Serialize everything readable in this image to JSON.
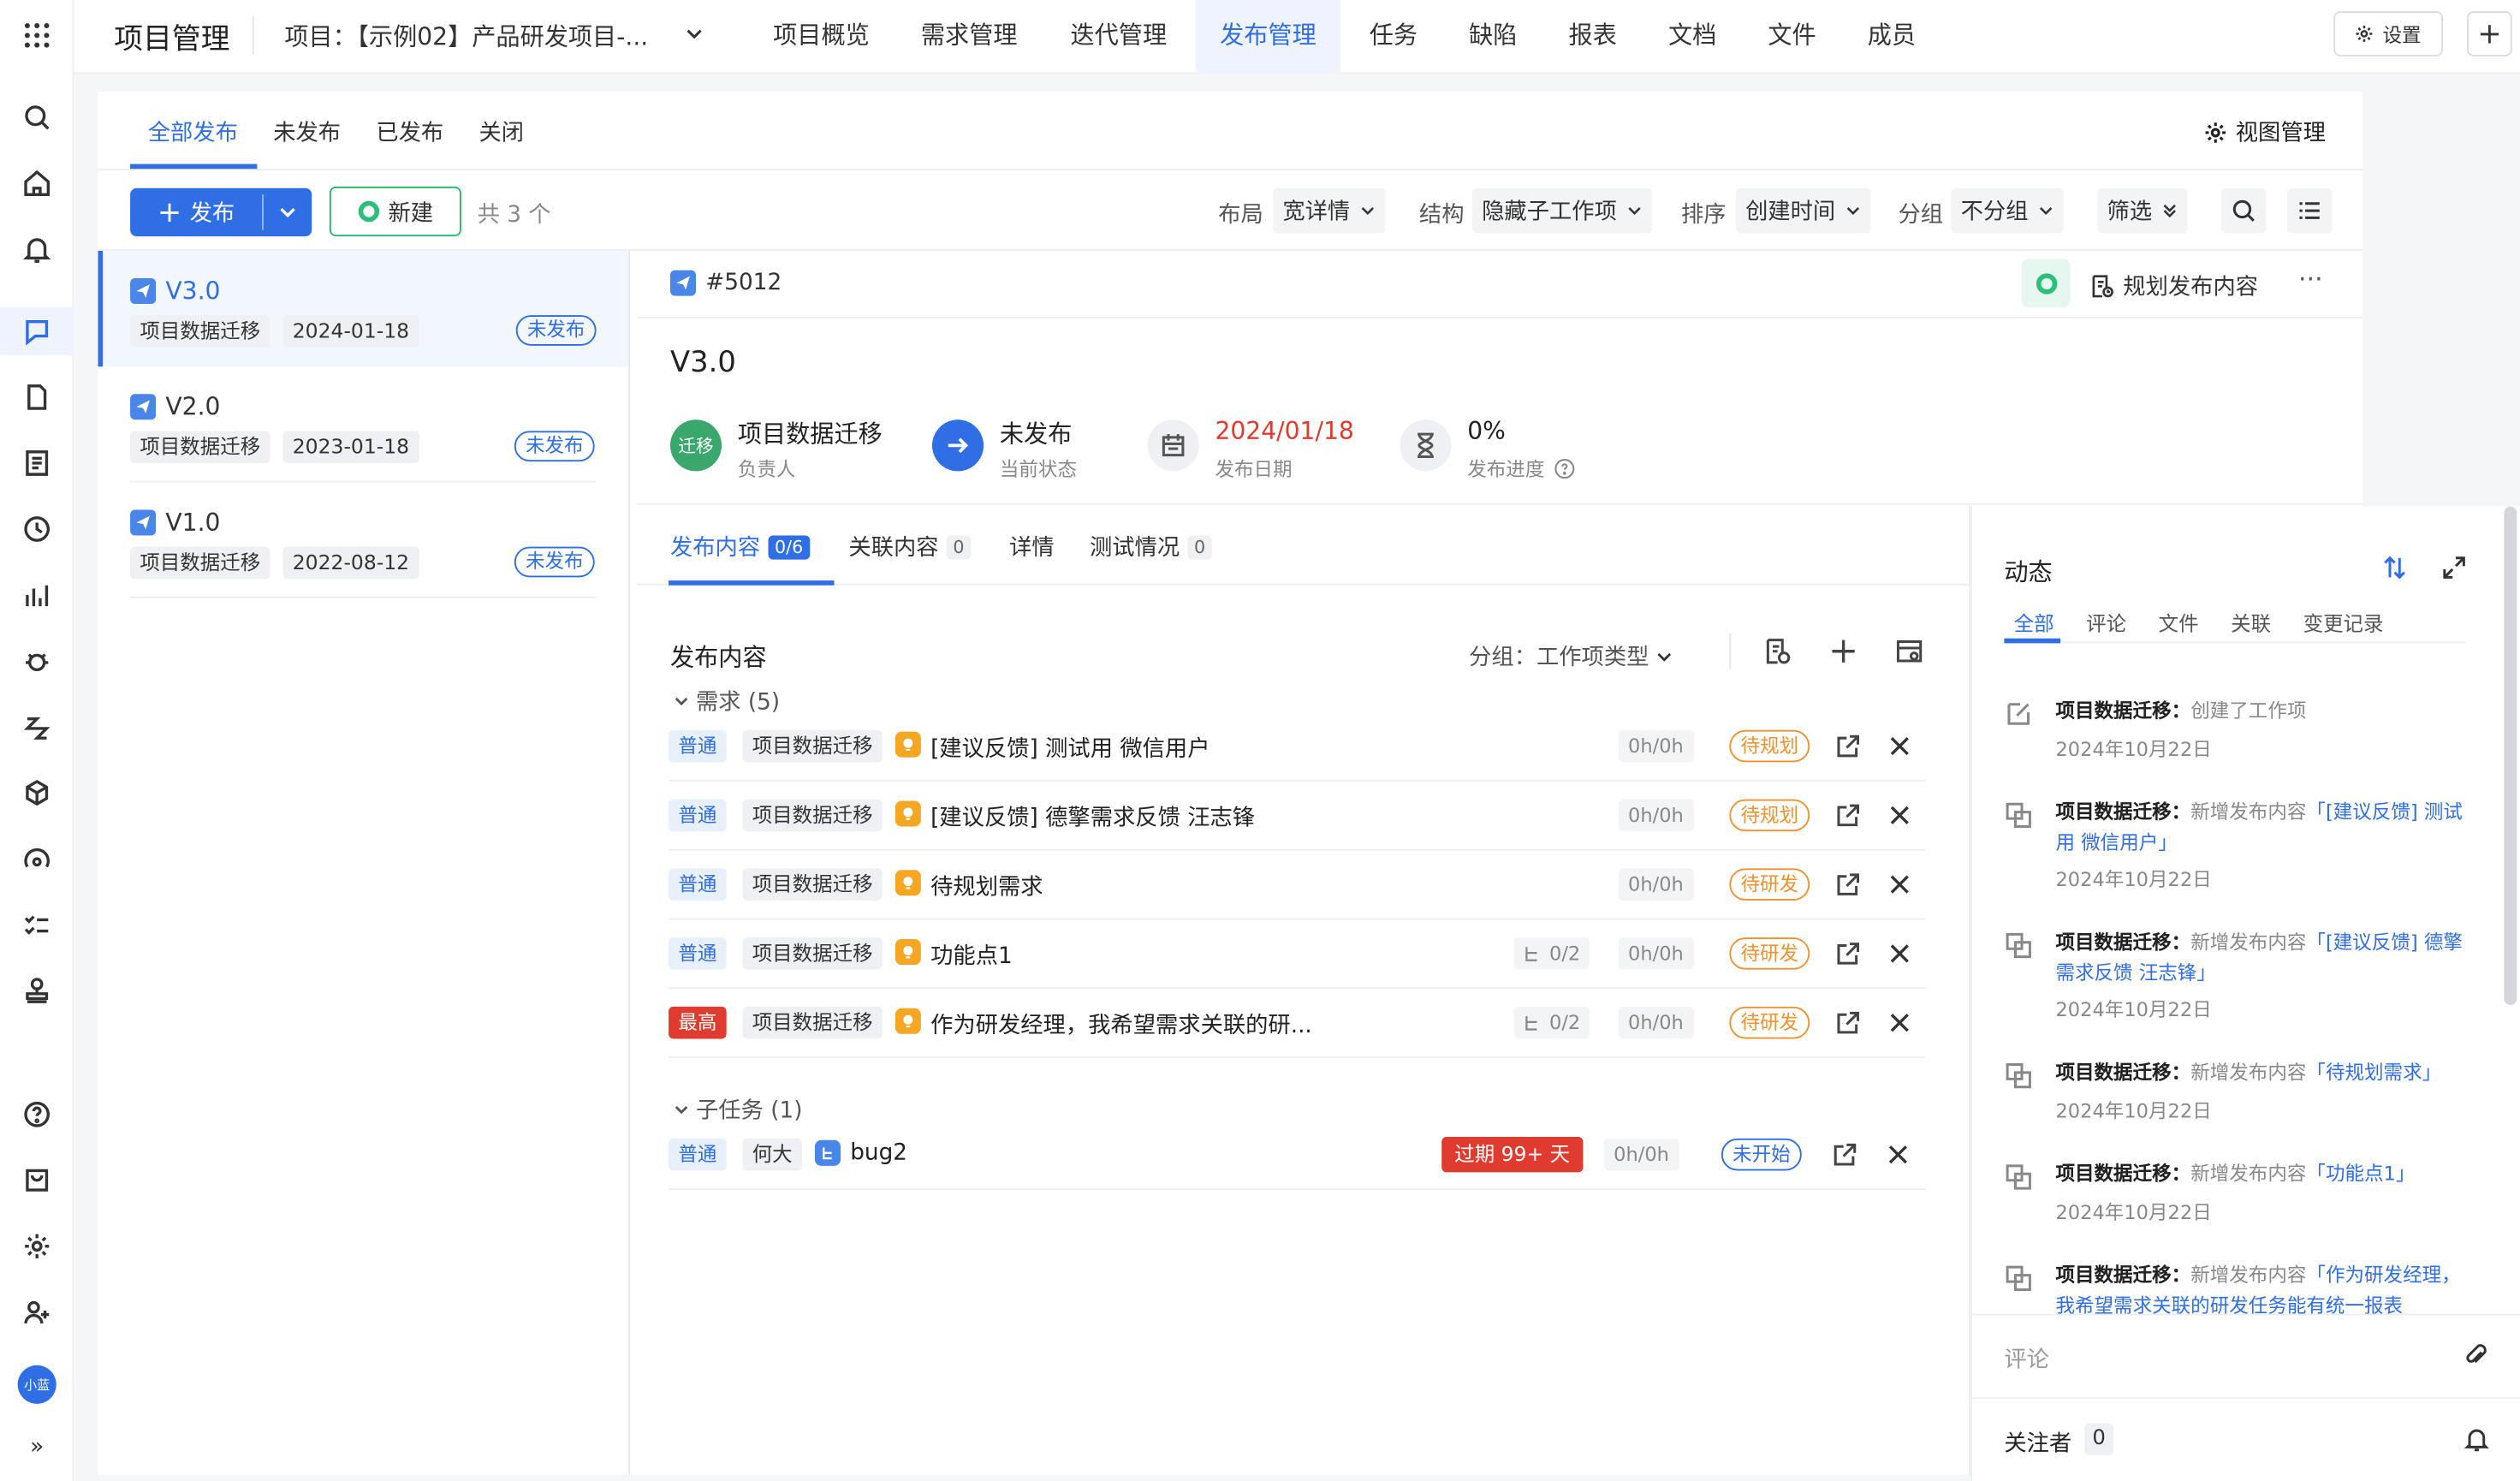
{
  "app": {
    "title": "项目管理",
    "project": "项目：【示例02】产品研发项目-..."
  },
  "nav": [
    "项目概览",
    "需求管理",
    "迭代管理",
    "发布管理",
    "任务",
    "缺陷",
    "报表",
    "文档",
    "文件",
    "成员"
  ],
  "settings_label": "设置",
  "avatar_text": "小蓝",
  "subtabs": [
    "全部发布",
    "未发布",
    "已发布",
    "关闭"
  ],
  "view_manage": "视图管理",
  "toolbar": {
    "publish_label": "发布",
    "new_label": "新建",
    "total": "共 3 个",
    "layout_label": "布局",
    "layout_value": "宽详情",
    "structure_label": "结构",
    "structure_value": "隐藏子工作项",
    "sort_label": "排序",
    "sort_value": "创建时间",
    "group_label": "分组",
    "group_value": "不分组",
    "filter_label": "筛选"
  },
  "releases": [
    {
      "version": "V3.0",
      "owner": "项目数据迁移",
      "date": "2024-01-18",
      "status": "未发布"
    },
    {
      "version": "V2.0",
      "owner": "项目数据迁移",
      "date": "2023-01-18",
      "status": "未发布"
    },
    {
      "version": "V1.0",
      "owner": "项目数据迁移",
      "date": "2022-08-12",
      "status": "未发布"
    }
  ],
  "detail": {
    "id": "#5012",
    "plan_label": "规划发布内容",
    "more": "···",
    "title": "V3.0",
    "owner_badge": "迁移",
    "owner": "项目数据迁移",
    "owner_label": "负责人",
    "state": "未发布",
    "state_label": "当前状态",
    "date": "2024/01/18",
    "date_label": "发布日期",
    "progress": "0%",
    "progress_label": "发布进度",
    "date_color": "#e03b2f"
  },
  "content_tabs": [
    {
      "label": "发布内容",
      "count": "0/6"
    },
    {
      "label": "关联内容",
      "count": "0"
    },
    {
      "label": "详情",
      "count": ""
    },
    {
      "label": "测试情况",
      "count": "0"
    }
  ],
  "content": {
    "section_title": "发布内容",
    "group_by": "分组：工作项类型",
    "groups": [
      {
        "label": "需求 (5)"
      },
      {
        "label": "子任务 (1)"
      }
    ],
    "rows": [
      {
        "priority": "普通",
        "owner": "项目数据迁移",
        "title": "[建议反馈] 测试用 微信用户",
        "subcount": "",
        "hours": "0h/0h",
        "status": "待规划"
      },
      {
        "priority": "普通",
        "owner": "项目数据迁移",
        "title": "[建议反馈] 德擎需求反馈 汪志锋",
        "subcount": "",
        "hours": "0h/0h",
        "status": "待规划"
      },
      {
        "priority": "普通",
        "owner": "项目数据迁移",
        "title": "待规划需求",
        "subcount": "",
        "hours": "0h/0h",
        "status": "待研发"
      },
      {
        "priority": "普通",
        "owner": "项目数据迁移",
        "title": "功能点1",
        "subcount": "0/2",
        "hours": "0h/0h",
        "status": "待研发"
      },
      {
        "priority": "最高",
        "owner": "项目数据迁移",
        "title": "作为研发经理，我希望需求关联的研...",
        "subcount": "0/2",
        "hours": "0h/0h",
        "status": "待研发"
      },
      {
        "priority": "普通",
        "owner": "何大",
        "title": "bug2",
        "overdue": "过期 99+ 天",
        "hours": "0h/0h",
        "status": "未开始"
      }
    ]
  },
  "activity": {
    "title": "动态",
    "tabs": [
      "全部",
      "评论",
      "文件",
      "关联",
      "变更记录"
    ],
    "items": [
      {
        "who": "项目数据迁移：",
        "action": "创建了工作项",
        "link": "",
        "date": "2024年10月22日"
      },
      {
        "who": "项目数据迁移：",
        "action": "新增发布内容",
        "link": "「[建议反馈] 测试用 微信用户」",
        "date": "2024年10月22日"
      },
      {
        "who": "项目数据迁移：",
        "action": "新增发布内容",
        "link": "「[建议反馈] 德擎需求反馈 汪志锋」",
        "date": "2024年10月22日"
      },
      {
        "who": "项目数据迁移：",
        "action": "新增发布内容",
        "link": "「待规划需求」",
        "date": "2024年10月22日"
      },
      {
        "who": "项目数据迁移：",
        "action": "新增发布内容",
        "link": "「功能点1」",
        "date": "2024年10月22日"
      },
      {
        "who": "项目数据迁移：",
        "action": "新增发布内容",
        "link": "「作为研发经理，我希望需求关联的研发任务能有统一报表",
        "date": ""
      }
    ],
    "comment_placeholder": "评论",
    "followers_label": "关注者",
    "followers_count": "0"
  },
  "colors": {
    "accent": "#2f6ee5",
    "danger": "#e03b2f",
    "success": "#2cbf7b",
    "warning": "#f0922f"
  }
}
